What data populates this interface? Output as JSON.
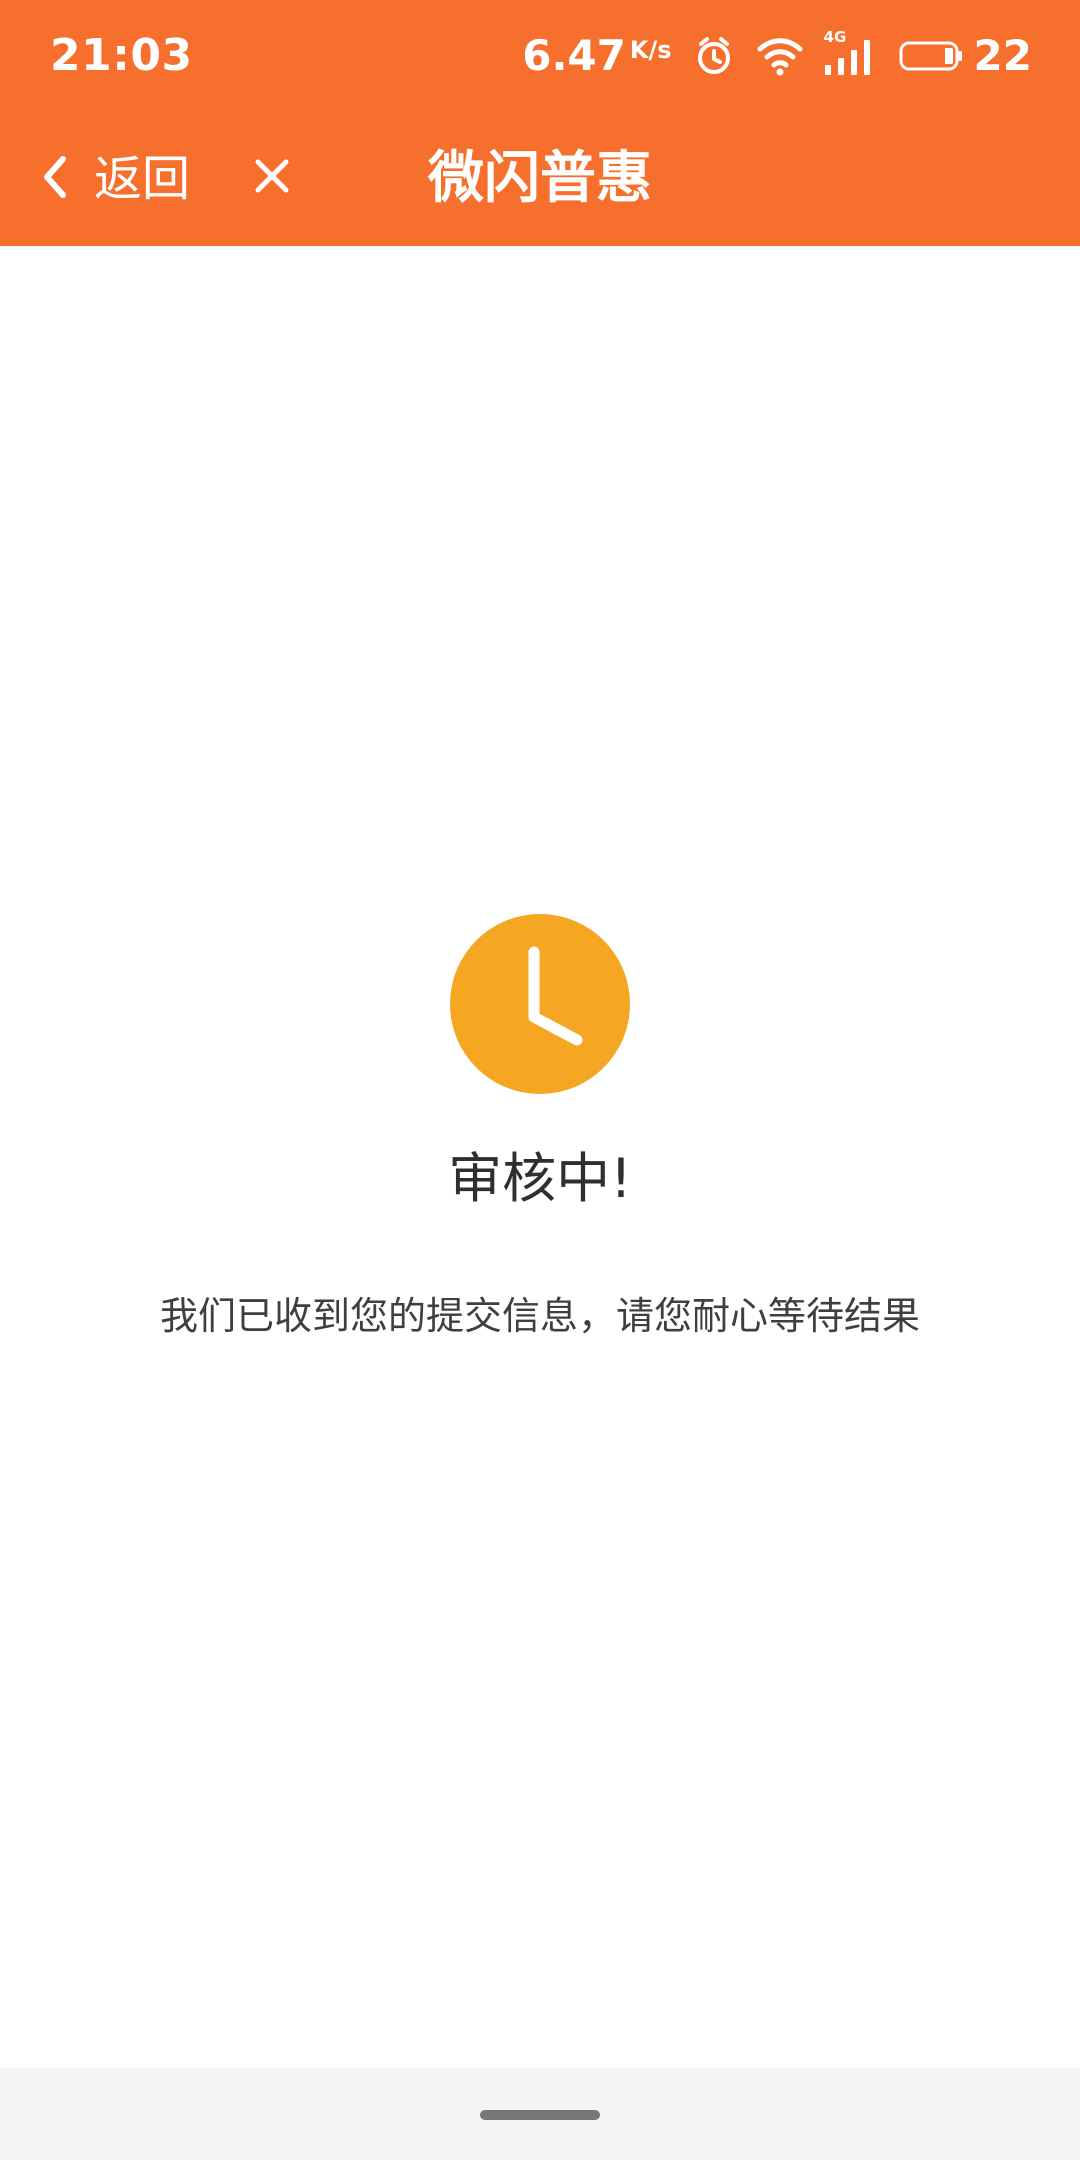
{
  "status_bar": {
    "time": "21:03",
    "network_speed_value": "6.47",
    "network_speed_unit": "K/s",
    "network_type": "4G",
    "battery_level": "22",
    "icons": {
      "alarm": "alarm-clock-icon",
      "wifi": "wifi-icon",
      "signal": "cellular-signal-icon",
      "battery": "battery-icon"
    }
  },
  "nav_bar": {
    "back_label": "返回",
    "title": "微闪普惠",
    "icons": {
      "back": "chevron-left-icon",
      "close": "close-icon"
    }
  },
  "review_status": {
    "title": "审核中!",
    "message": "我们已收到您的提交信息，请您耐心等待结果",
    "icon": "clock-icon"
  },
  "colors": {
    "header_orange": "#f76f2c",
    "clock_yellow": "#f5a623",
    "title_text": "#2f2f2f",
    "message_text": "#3f3f3f",
    "page_background": "#ffffff",
    "gesture_background": "#f5f5f5",
    "home_indicator": "#777777"
  }
}
